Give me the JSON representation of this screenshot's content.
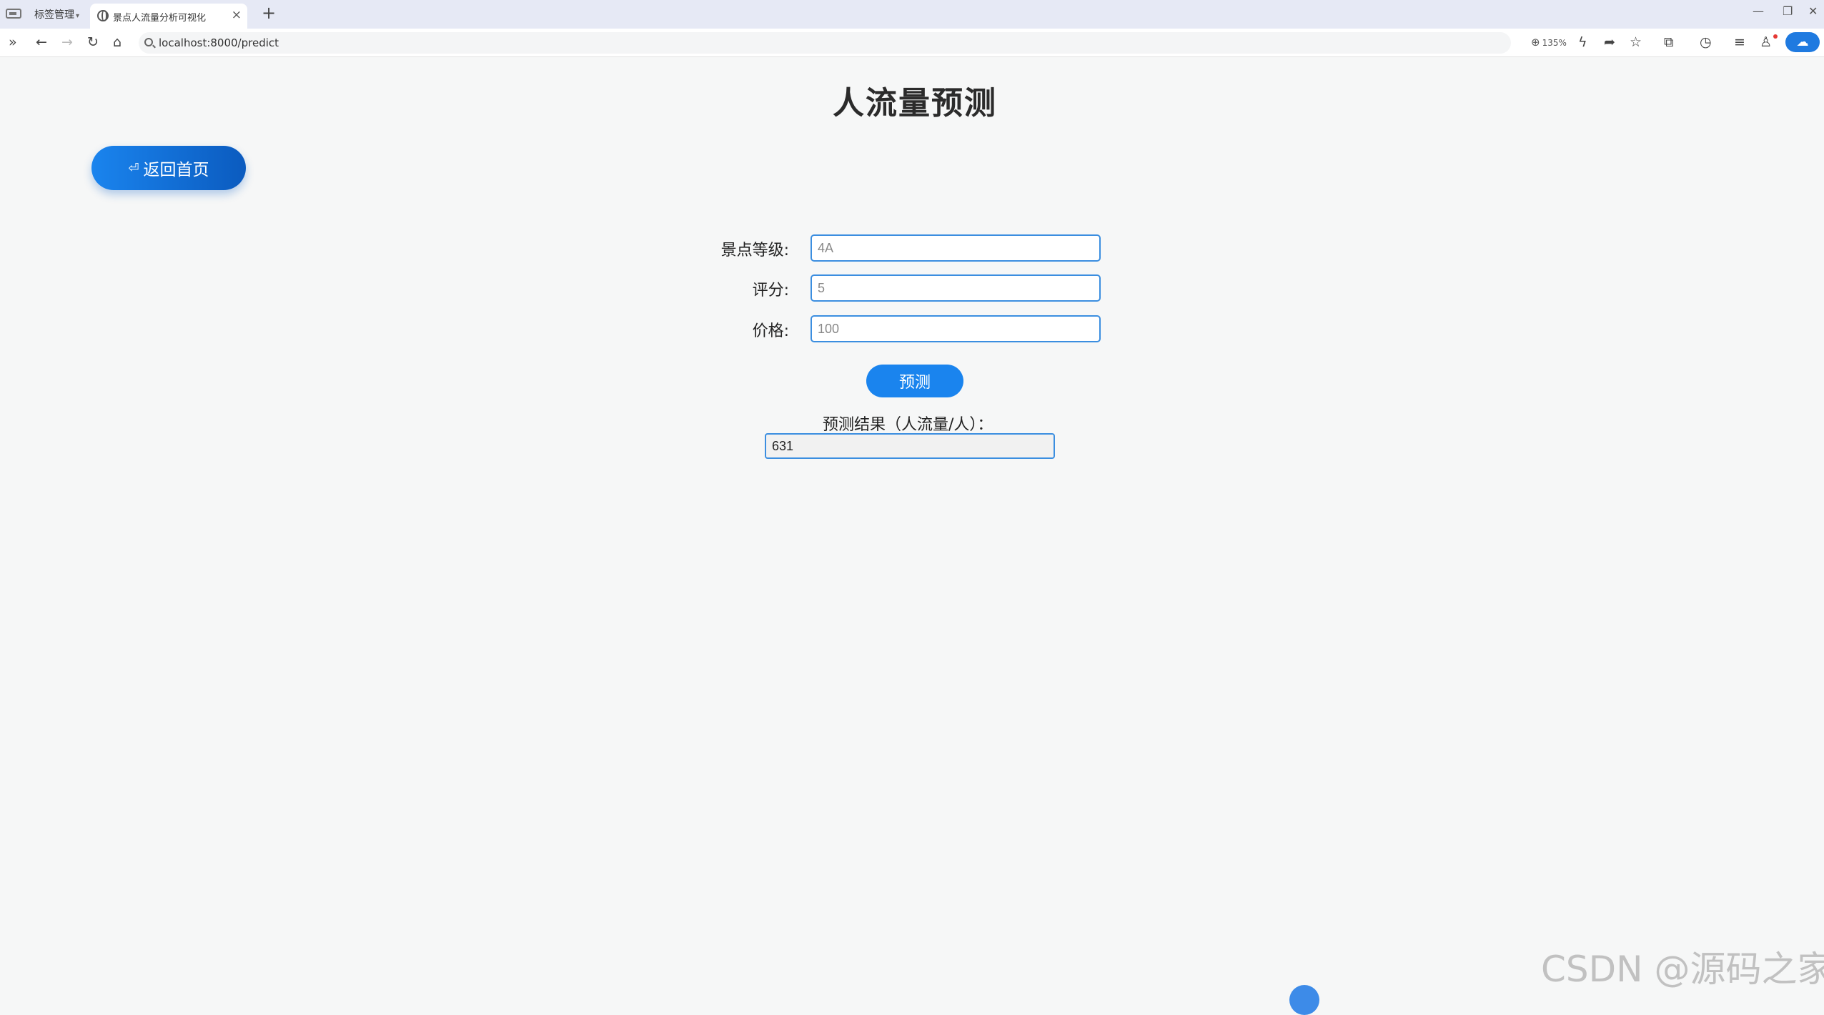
{
  "browser": {
    "group_tab_label": "标签管理",
    "active_tab_title": "景点人流量分析可视化",
    "url": "localhost:8000/predict",
    "zoom": "135%"
  },
  "page": {
    "title": "人流量预测",
    "back_button": "返回首页",
    "form": {
      "level_label": "景点等级:",
      "level_placeholder": "4A",
      "rating_label": "评分:",
      "rating_placeholder": "5",
      "price_label": "价格:",
      "price_placeholder": "100"
    },
    "predict_button": "预测",
    "result_label": "预测结果（人流量/人）：",
    "result_value": "631"
  },
  "watermark": "CSDN @源码之家",
  "colors": {
    "accent": "#1a84ee",
    "input_border": "#3b8ee0",
    "page_bg": "#f6f7f7"
  }
}
